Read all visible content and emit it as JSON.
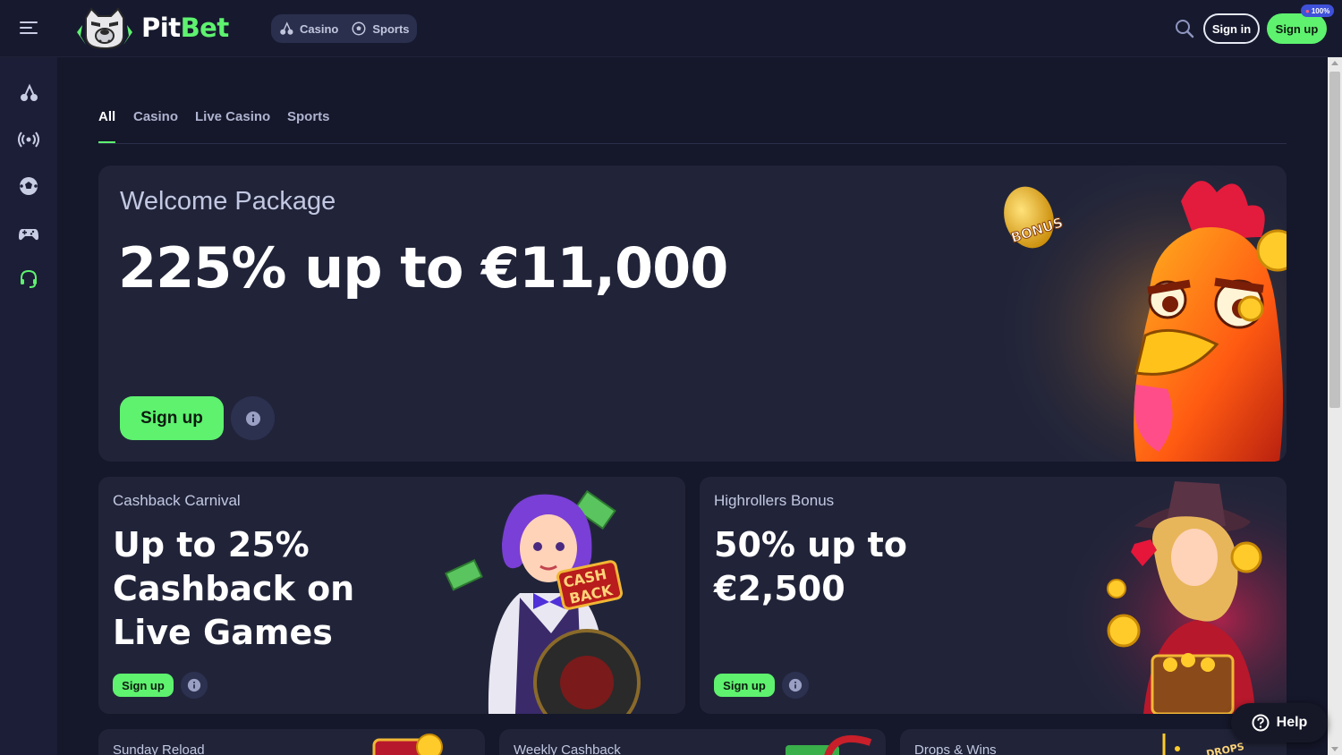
{
  "brand": {
    "name_part1": "Pit",
    "name_part2": "Bet"
  },
  "top_nav": {
    "items": [
      {
        "label": "Casino",
        "icon": "cherry-icon"
      },
      {
        "label": "Sports",
        "icon": "soccer-ball-icon"
      }
    ]
  },
  "header": {
    "signin_label": "Sign in",
    "signup_label": "Sign up",
    "signup_badge": "100%"
  },
  "sidebar": {
    "icons": [
      "cherry-icon",
      "live-broadcast-icon",
      "soccer-ball-icon",
      "gamepad-icon",
      "headset-support-icon"
    ]
  },
  "tabs": [
    {
      "label": "All",
      "active": true
    },
    {
      "label": "Casino"
    },
    {
      "label": "Live Casino"
    },
    {
      "label": "Sports"
    }
  ],
  "hero": {
    "subtitle": "Welcome Package",
    "title": "225% up to €11,000",
    "cta": "Sign up",
    "art_text": "BONUS"
  },
  "promos": [
    {
      "subtitle": "Cashback Carnival",
      "title": "Up to 25% Cashback on Live Games",
      "cta": "Sign up",
      "art_text": "CASH BACK"
    },
    {
      "subtitle": "Highrollers Bonus",
      "title": "50% up to €2,500",
      "cta": "Sign up"
    }
  ],
  "mini_cards": [
    {
      "title": "Sunday Reload"
    },
    {
      "title": "Weekly Cashback"
    },
    {
      "title": "Drops & Wins",
      "art_text": "DROPS WINS"
    }
  ],
  "help": {
    "label": "Help"
  },
  "colors": {
    "accent": "#5ef26f",
    "background": "#15172a",
    "card": "#212439",
    "sidebar": "#1b1e36"
  }
}
